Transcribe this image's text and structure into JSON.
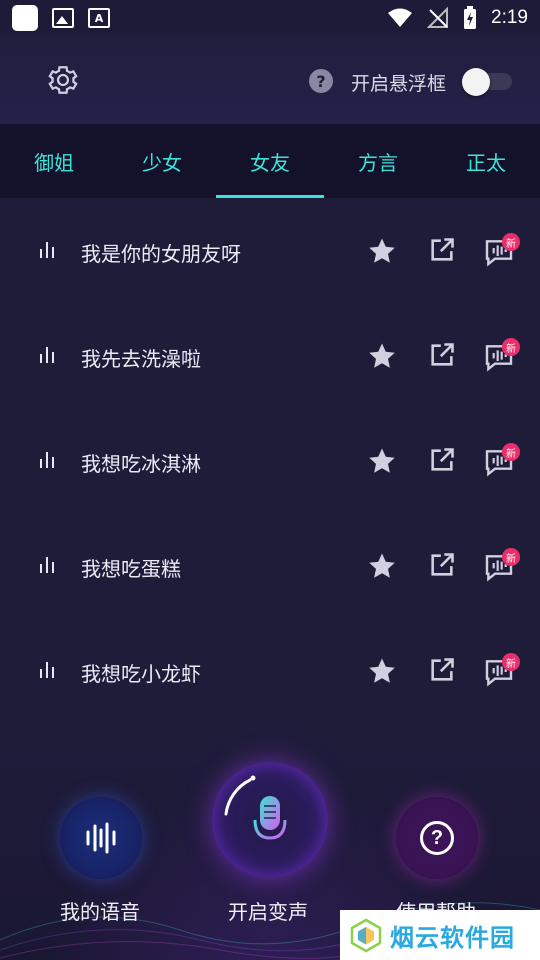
{
  "status_bar": {
    "time": "2:19"
  },
  "header": {
    "floating_window_label": "开启悬浮框",
    "help_symbol": "?",
    "floating_window_enabled": false
  },
  "tabs": [
    {
      "label": "御姐",
      "active": false
    },
    {
      "label": "少女",
      "active": false
    },
    {
      "label": "女友",
      "active": true
    },
    {
      "label": "方言",
      "active": false
    },
    {
      "label": "正太",
      "active": false
    }
  ],
  "voice_items": [
    {
      "text": "我是你的女朋友呀",
      "badge": "新"
    },
    {
      "text": "我先去洗澡啦",
      "badge": "新"
    },
    {
      "text": "我想吃冰淇淋",
      "badge": "新"
    },
    {
      "text": "我想吃蛋糕",
      "badge": "新"
    },
    {
      "text": "我想吃小龙虾",
      "badge": "新"
    }
  ],
  "bottom_nav": {
    "my_voice_label": "我的语音",
    "start_voice_change_label": "开启变声",
    "help_label": "使用帮助",
    "help_symbol": "?"
  },
  "watermark": {
    "text": "烟云软件园"
  },
  "colors": {
    "accent": "#3fe2d6",
    "background": "#1f1c3a",
    "tab_bar": "#14122b",
    "badge": "#ec2d6b"
  },
  "icons": {
    "settings": "gear-icon",
    "help": "help-icon",
    "bars": "audio-bars-icon",
    "favorite": "star-icon",
    "share": "share-icon",
    "voice": "voice-message-icon",
    "microphone": "microphone-icon"
  }
}
